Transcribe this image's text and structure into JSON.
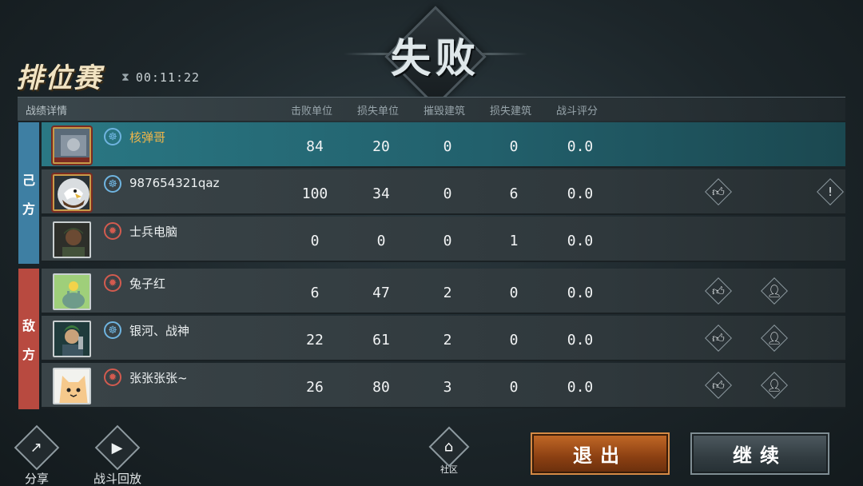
{
  "header": {
    "result": "失败",
    "mode": "排位赛",
    "timer": "00:11:22"
  },
  "table": {
    "title": "战绩详情",
    "columns": [
      "击败单位",
      "损失单位",
      "摧毁建筑",
      "损失建筑",
      "战斗评分"
    ]
  },
  "teams": {
    "ally_label": [
      "己",
      "方"
    ],
    "enemy_label": [
      "敌",
      "方"
    ]
  },
  "rows": [
    {
      "name": "核弹哥",
      "faction": "blue",
      "kills": "84",
      "losses": "20",
      "destroyed": "0",
      "lost_buildings": "0",
      "score": "0.0"
    },
    {
      "name": "987654321qaz",
      "faction": "blue",
      "kills": "100",
      "losses": "34",
      "destroyed": "0",
      "lost_buildings": "6",
      "score": "0.0"
    },
    {
      "name": "士兵电脑",
      "faction": "red",
      "kills": "0",
      "losses": "0",
      "destroyed": "0",
      "lost_buildings": "1",
      "score": "0.0"
    },
    {
      "name": "兔子红",
      "faction": "red",
      "kills": "6",
      "losses": "47",
      "destroyed": "2",
      "lost_buildings": "0",
      "score": "0.0"
    },
    {
      "name": "银河、战神",
      "faction": "blue",
      "kills": "22",
      "losses": "61",
      "destroyed": "2",
      "lost_buildings": "0",
      "score": "0.0"
    },
    {
      "name": "张张张张~",
      "faction": "red",
      "kills": "26",
      "losses": "80",
      "destroyed": "3",
      "lost_buildings": "0",
      "score": "0.0"
    }
  ],
  "bottom": {
    "share": "分享",
    "replay": "战斗回放",
    "community": "社区",
    "exit": "退出",
    "continue": "继续"
  },
  "icons": {
    "like": "thumbs-up-icon",
    "add_friend": "add-friend-icon",
    "report": "report-icon",
    "share": "share-icon",
    "replay": "camera-icon",
    "home": "home-icon",
    "hourglass": "hourglass-icon"
  },
  "colors": {
    "ally": "#3e7fa3",
    "enemy": "#b84a40",
    "highlight_row": "#2a7884",
    "self_name": "#f0b64a"
  }
}
